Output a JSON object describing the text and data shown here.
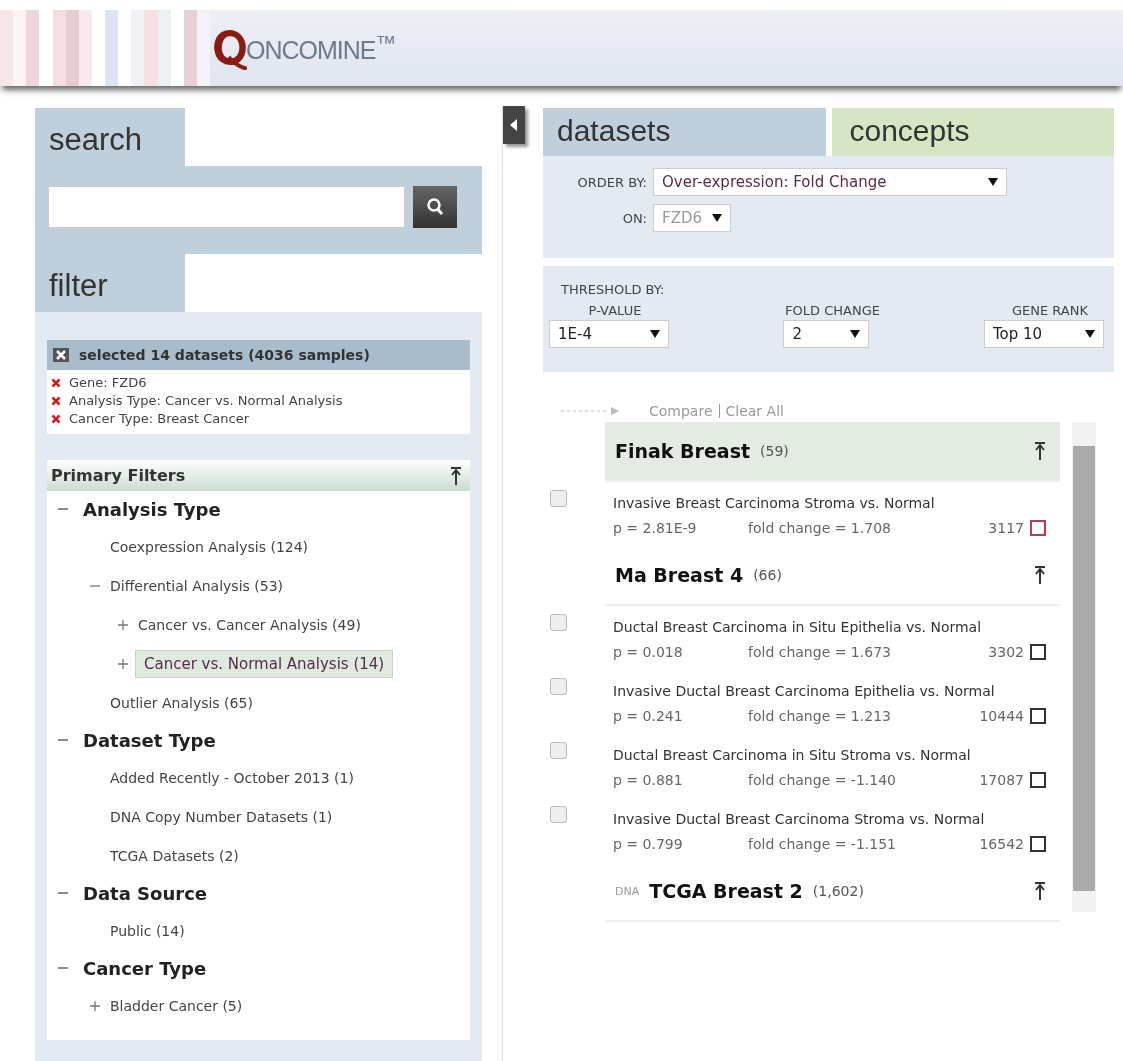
{
  "header": {
    "logo": "ONCOMINE$^{™}$"
  },
  "left": {
    "search_tab": {
      "label": "search"
    },
    "filter_tab": {
      "label": "filter"
    },
    "summary": "selected 14 datasets (4036 samples)",
    "filters": [
      "Gene: FZD6",
      "Analysis Type: Cancer vs. Normal Analysis",
      "Cancer Type: Breast Cancer"
    ],
    "primary_filters": {
      "title": "Primary Filters",
      "groups": [
        {
          "label": "Analysis Type",
          "expanded": true,
          "children": [
            {
              "label": "Coexpression Analysis (124)",
              "kind": "leaf",
              "selected": false
            },
            {
              "label": "Differential Analysis (53)",
              "kind": "branch",
              "expanded": true,
              "selected": false,
              "children": [
                {
                  "label": "Cancer vs. Cancer Analysis (49)",
                  "kind": "branch",
                  "expanded": false,
                  "selected": false
                },
                {
                  "label": "Cancer vs. Normal Analysis (14)",
                  "kind": "branch",
                  "expanded": false,
                  "selected": true
                }
              ]
            },
            {
              "label": "Outlier Analysis (65)",
              "kind": "leaf",
              "selected": false
            }
          ]
        },
        {
          "label": "Dataset Type",
          "expanded": true,
          "children": [
            {
              "label": "Added Recently - October 2013 (1)",
              "kind": "leaf",
              "selected": false
            },
            {
              "label": "DNA Copy Number Datasets (1)",
              "kind": "leaf",
              "selected": false
            },
            {
              "label": "TCGA Datasets (2)",
              "kind": "leaf",
              "selected": false
            }
          ]
        },
        {
          "label": "Data Source",
          "expanded": true,
          "children": [
            {
              "label": "Public (14)",
              "kind": "leaf",
              "selected": false
            }
          ]
        },
        {
          "label": "Cancer Type",
          "expanded": true,
          "children": [
            {
              "label": "Bladder Cancer (5)",
              "kind": "branch",
              "expanded": false,
              "selected": false
            }
          ]
        }
      ]
    }
  },
  "right": {
    "tabs": [
      {
        "label": "datasets",
        "selected": true
      },
      {
        "label": "concepts",
        "selected": false
      }
    ],
    "order_by": {
      "label": "ORDER BY:",
      "value": "Over-expression: Fold Change"
    },
    "on": {
      "label": "ON:",
      "value": "FZD6",
      "disabled": true
    },
    "threshold": {
      "label": "THRESHOLD BY:",
      "fields": [
        {
          "label": "P-VALUE",
          "value": "1E-4"
        },
        {
          "label": "FOLD CHANGE",
          "value": "2"
        },
        {
          "label": "GENE RANK",
          "value": "Top 10"
        }
      ]
    },
    "links": [
      "Compare",
      "Clear All"
    ],
    "datasets": [
      {
        "name": "Finak Breast",
        "count": "(59)",
        "highlighted": true,
        "analyses": [
          {
            "title": "Invasive Breast Carcinoma Stroma vs. Normal",
            "p": "p = 2.81E-9",
            "fold": "fold change = 1.708",
            "rank": "3117",
            "color": "#b0405a",
            "checked": false
          }
        ]
      },
      {
        "name": "Ma Breast 4",
        "count": "(66)",
        "highlighted": false,
        "analyses": [
          {
            "title": "Ductal Breast Carcinoma in Situ Epithelia vs. Normal",
            "p": "p = 0.018",
            "fold": "fold change = 1.673",
            "rank": "3302",
            "color": "#333333",
            "checked": false
          },
          {
            "title": "Invasive Ductal Breast Carcinoma Epithelia vs. Normal",
            "p": "p = 0.241",
            "fold": "fold change = 1.213",
            "rank": "10444",
            "color": "#333333",
            "checked": false
          },
          {
            "title": "Ductal Breast Carcinoma in Situ Stroma vs. Normal",
            "p": "p = 0.881",
            "fold": "fold change = -1.140",
            "rank": "17087",
            "color": "#333333",
            "checked": false
          },
          {
            "title": "Invasive Ductal Breast Carcinoma Stroma vs. Normal",
            "p": "p = 0.799",
            "fold": "fold change = -1.151",
            "rank": "16542",
            "color": "#333333",
            "checked": false
          }
        ]
      },
      {
        "tag": "DNA",
        "name": "TCGA Breast 2",
        "count": "(1,602)",
        "highlighted": false
      }
    ]
  }
}
